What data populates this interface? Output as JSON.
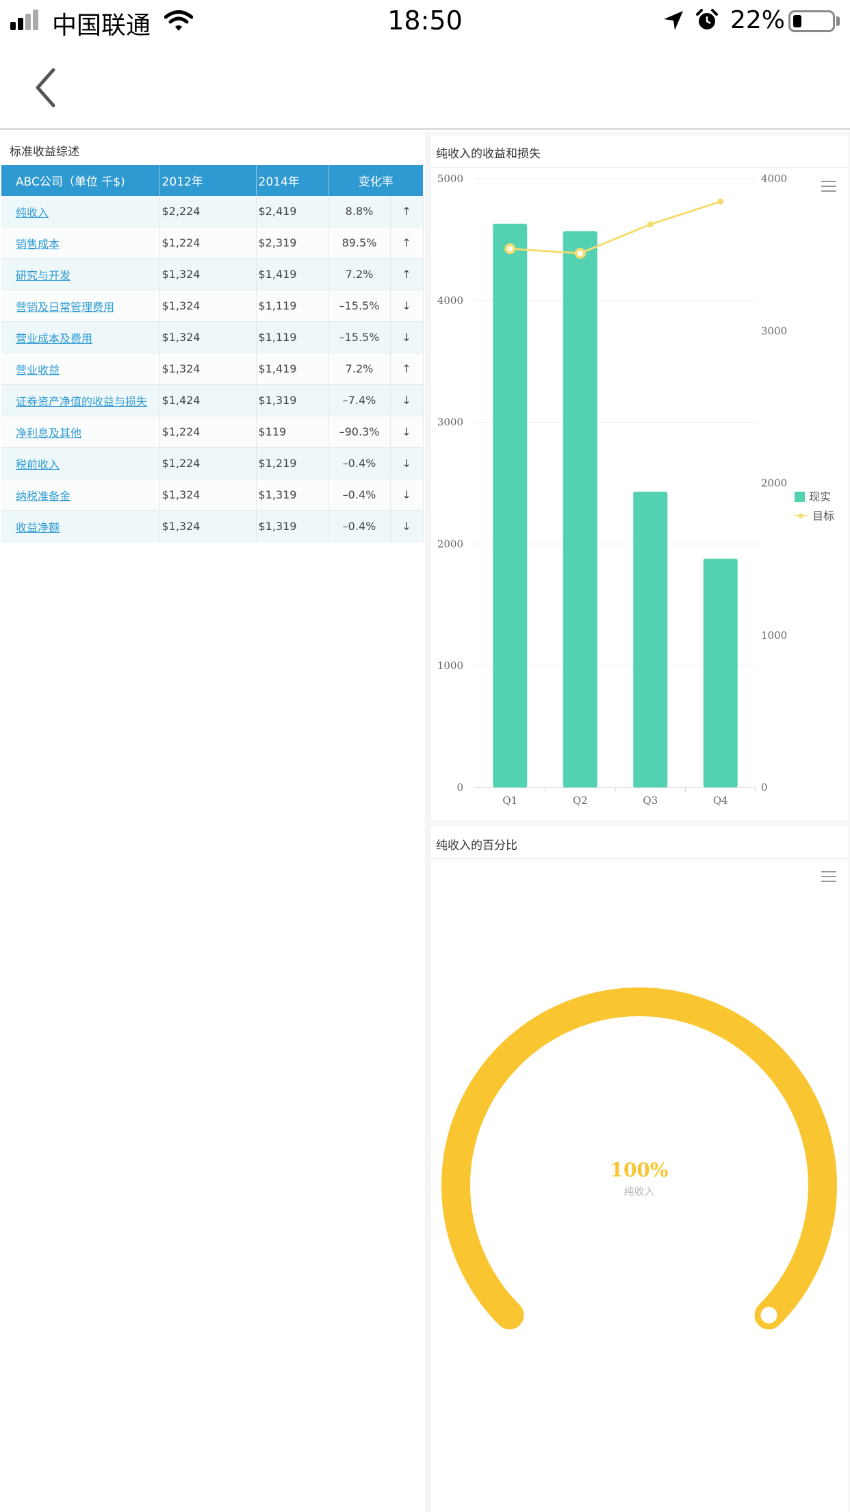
{
  "status_bar": {
    "carrier": "中国联通",
    "time": "18:50",
    "battery_pct": "22%",
    "battery_level": 0.22,
    "signal_bars": 2,
    "icons": [
      "signal-icon",
      "wifi-icon",
      "location-icon",
      "alarm-icon",
      "battery-icon"
    ]
  },
  "nav": {
    "back_icon": "chevron-left-icon"
  },
  "table_panel": {
    "title": "标准收益综述",
    "headers": [
      "ABC公司（单位 千$)",
      "2012年",
      "2014年",
      "变化率"
    ],
    "rows": [
      {
        "name": "纯收入",
        "y2012": "$2,224",
        "y2014": "$2,419",
        "rate": "8.8%",
        "trend": "up"
      },
      {
        "name": "销售成本",
        "y2012": "$1,224",
        "y2014": "$2,319",
        "rate": "89.5%",
        "trend": "up"
      },
      {
        "name": "研究与开发",
        "y2012": "$1,324",
        "y2014": "$1,419",
        "rate": "7.2%",
        "trend": "up"
      },
      {
        "name": "营销及日常管理费用",
        "y2012": "$1,324",
        "y2014": "$1,119",
        "rate": "–15.5%",
        "trend": "down"
      },
      {
        "name": "营业成本及费用",
        "y2012": "$1,324",
        "y2014": "$1,119",
        "rate": "–15.5%",
        "trend": "down"
      },
      {
        "name": "营业收益",
        "y2012": "$1,324",
        "y2014": "$1,419",
        "rate": "7.2%",
        "trend": "up"
      },
      {
        "name": "证券资产净值的收益与损失",
        "y2012": "$1,424",
        "y2014": "$1,319",
        "rate": "–7.4%",
        "trend": "down"
      },
      {
        "name": "净利息及其他",
        "y2012": "$1,224",
        "y2014": "$119",
        "rate": "–90.3%",
        "trend": "down"
      },
      {
        "name": "税前收入",
        "y2012": "$1,224",
        "y2014": "$1,219",
        "rate": "–0.4%",
        "trend": "down"
      },
      {
        "name": "纳税准备金",
        "y2012": "$1,324",
        "y2014": "$1,319",
        "rate": "–0.4%",
        "trend": "down"
      },
      {
        "name": "收益净额",
        "y2012": "$1,324",
        "y2014": "$1,319",
        "rate": "–0.4%",
        "trend": "down"
      }
    ],
    "colors": {
      "header": "#2f9ad2",
      "up": "#4fbe4f",
      "down": "#f5a04a"
    }
  },
  "bar_panel": {
    "title": "纯收入的收益和损失",
    "menu_icon": "menu-icon"
  },
  "gauge_panel": {
    "title": "纯收入的百分比",
    "menu_icon": "menu-icon"
  },
  "chart_data": [
    {
      "type": "bar",
      "title": "纯收入的收益和损失",
      "categories": [
        "Q1",
        "Q2",
        "Q3",
        "Q4"
      ],
      "y_ticks_left": [
        "0",
        "1000",
        "2000",
        "3000",
        "4000",
        "5000"
      ],
      "y_ticks_right": [
        "0",
        "1000",
        "2000",
        "3000",
        "4000"
      ],
      "ylim_left": [
        0,
        5000
      ],
      "ylim_right": [
        0,
        4000
      ],
      "series": [
        {
          "name": "现实",
          "kind": "bar",
          "axis": "left",
          "values": [
            4630,
            4570,
            2430,
            1880
          ],
          "color": "#53d1b0"
        },
        {
          "name": "目标",
          "kind": "line",
          "axis": "right",
          "values": [
            3540,
            3510,
            3700,
            3850
          ],
          "color": "#f3dd72"
        }
      ],
      "legend_position": "right",
      "grid": true
    },
    {
      "type": "gauge",
      "title": "纯收入的百分比",
      "value_label": "100%",
      "value": 100,
      "label": "纯收入",
      "color": "#f9c530"
    }
  ]
}
